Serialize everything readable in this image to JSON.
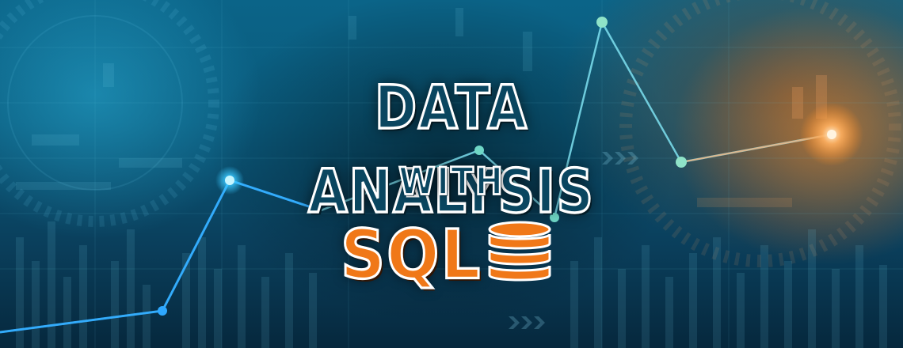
{
  "banner": {
    "title": "DATA ANALYSIS",
    "subtitle": "WITH",
    "highlight": "SQL",
    "icon": "database-icon",
    "colors": {
      "title_fill": "#0a4660",
      "outline": "#ffffff",
      "highlight": "#f07818",
      "background_blue": "#0a5a7c",
      "glow_orange": "#ff8c28"
    }
  }
}
